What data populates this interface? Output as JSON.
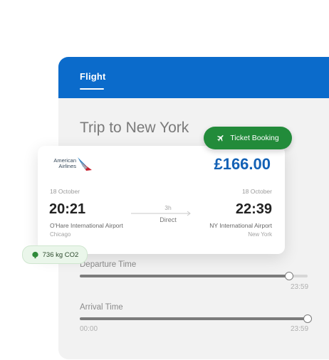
{
  "header": {
    "tab_label": "Flight"
  },
  "trip": {
    "title": "Trip to New York"
  },
  "ticket": {
    "airline_line1": "American",
    "airline_line2": "Airlines",
    "price": "£166.00",
    "departure": {
      "date": "18 October",
      "time": "20:21",
      "airport": "O'Hare International Airport",
      "city": "Chicago"
    },
    "arrival": {
      "date": "18 October",
      "time": "22:39",
      "airport": "NY International Airport",
      "city": "New York"
    },
    "duration": "3h",
    "stops": "Direct"
  },
  "booking_button": {
    "label": "Ticket Booking",
    "icon": "airplane-icon",
    "color": "#228b3a"
  },
  "co2_badge": {
    "label": "736 kg CO2",
    "icon": "leaf-icon"
  },
  "departure_slider": {
    "label": "Departure Time",
    "max_label": "23:59",
    "fill_fraction": 0.92
  },
  "arrival_slider": {
    "label": "Arrival Time",
    "min_label": "00:00",
    "max_label": "23:59",
    "fill_fraction": 1.0
  },
  "colors": {
    "header_blue": "#0b6bcb",
    "price_blue": "#1361b5",
    "green": "#228b3a"
  }
}
